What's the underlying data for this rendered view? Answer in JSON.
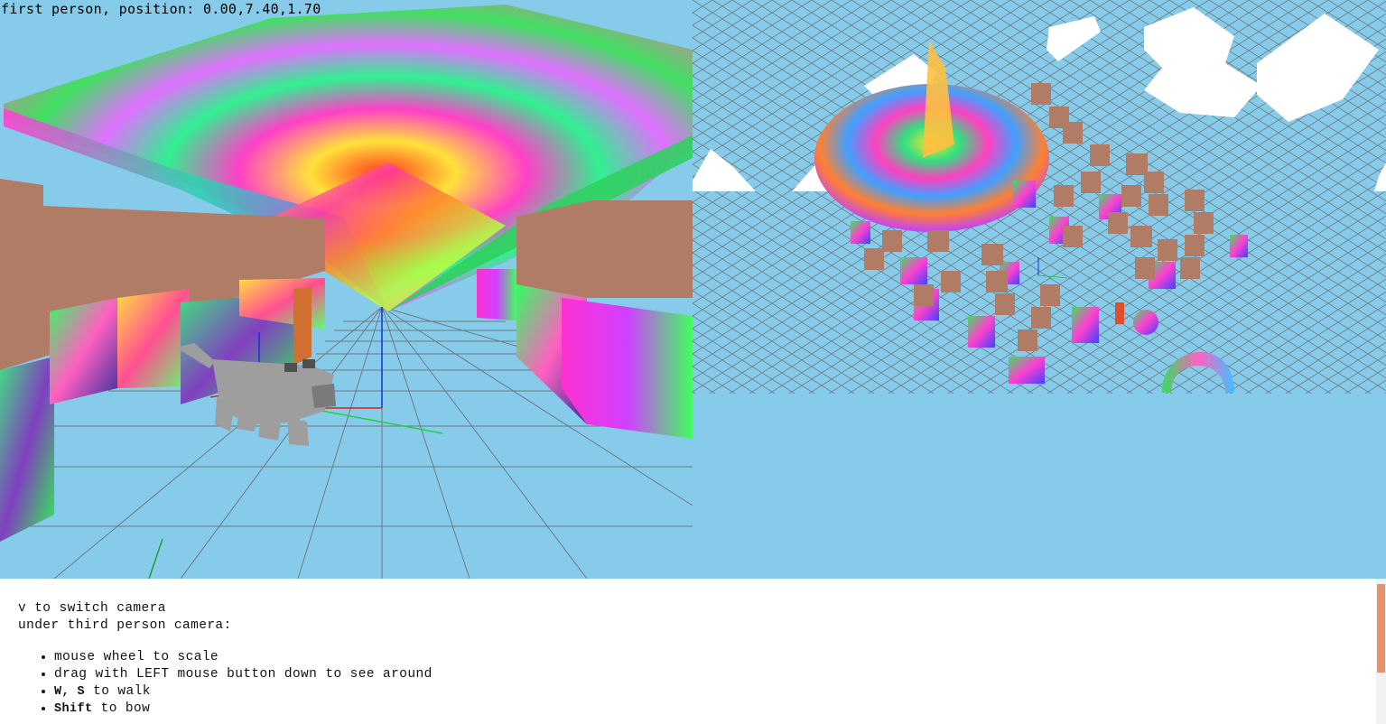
{
  "hud": {
    "camera_status": "first person, position: 0.00,7.40,1.70"
  },
  "instructions": {
    "switch_line": "v to switch camera",
    "third_person_header": "under third person camera:",
    "items": [
      {
        "key": "",
        "text": "mouse wheel to scale"
      },
      {
        "key": "",
        "text": "drag with LEFT mouse button down to see around"
      },
      {
        "key": "W, S",
        "text": " to walk"
      },
      {
        "key": "Shift",
        "text": " to bow"
      }
    ]
  },
  "colors": {
    "sky": "#87cbea",
    "building_top": "#b07c66",
    "cloud": "#ffffff",
    "scrollbar_thumb": "#e8916a"
  }
}
